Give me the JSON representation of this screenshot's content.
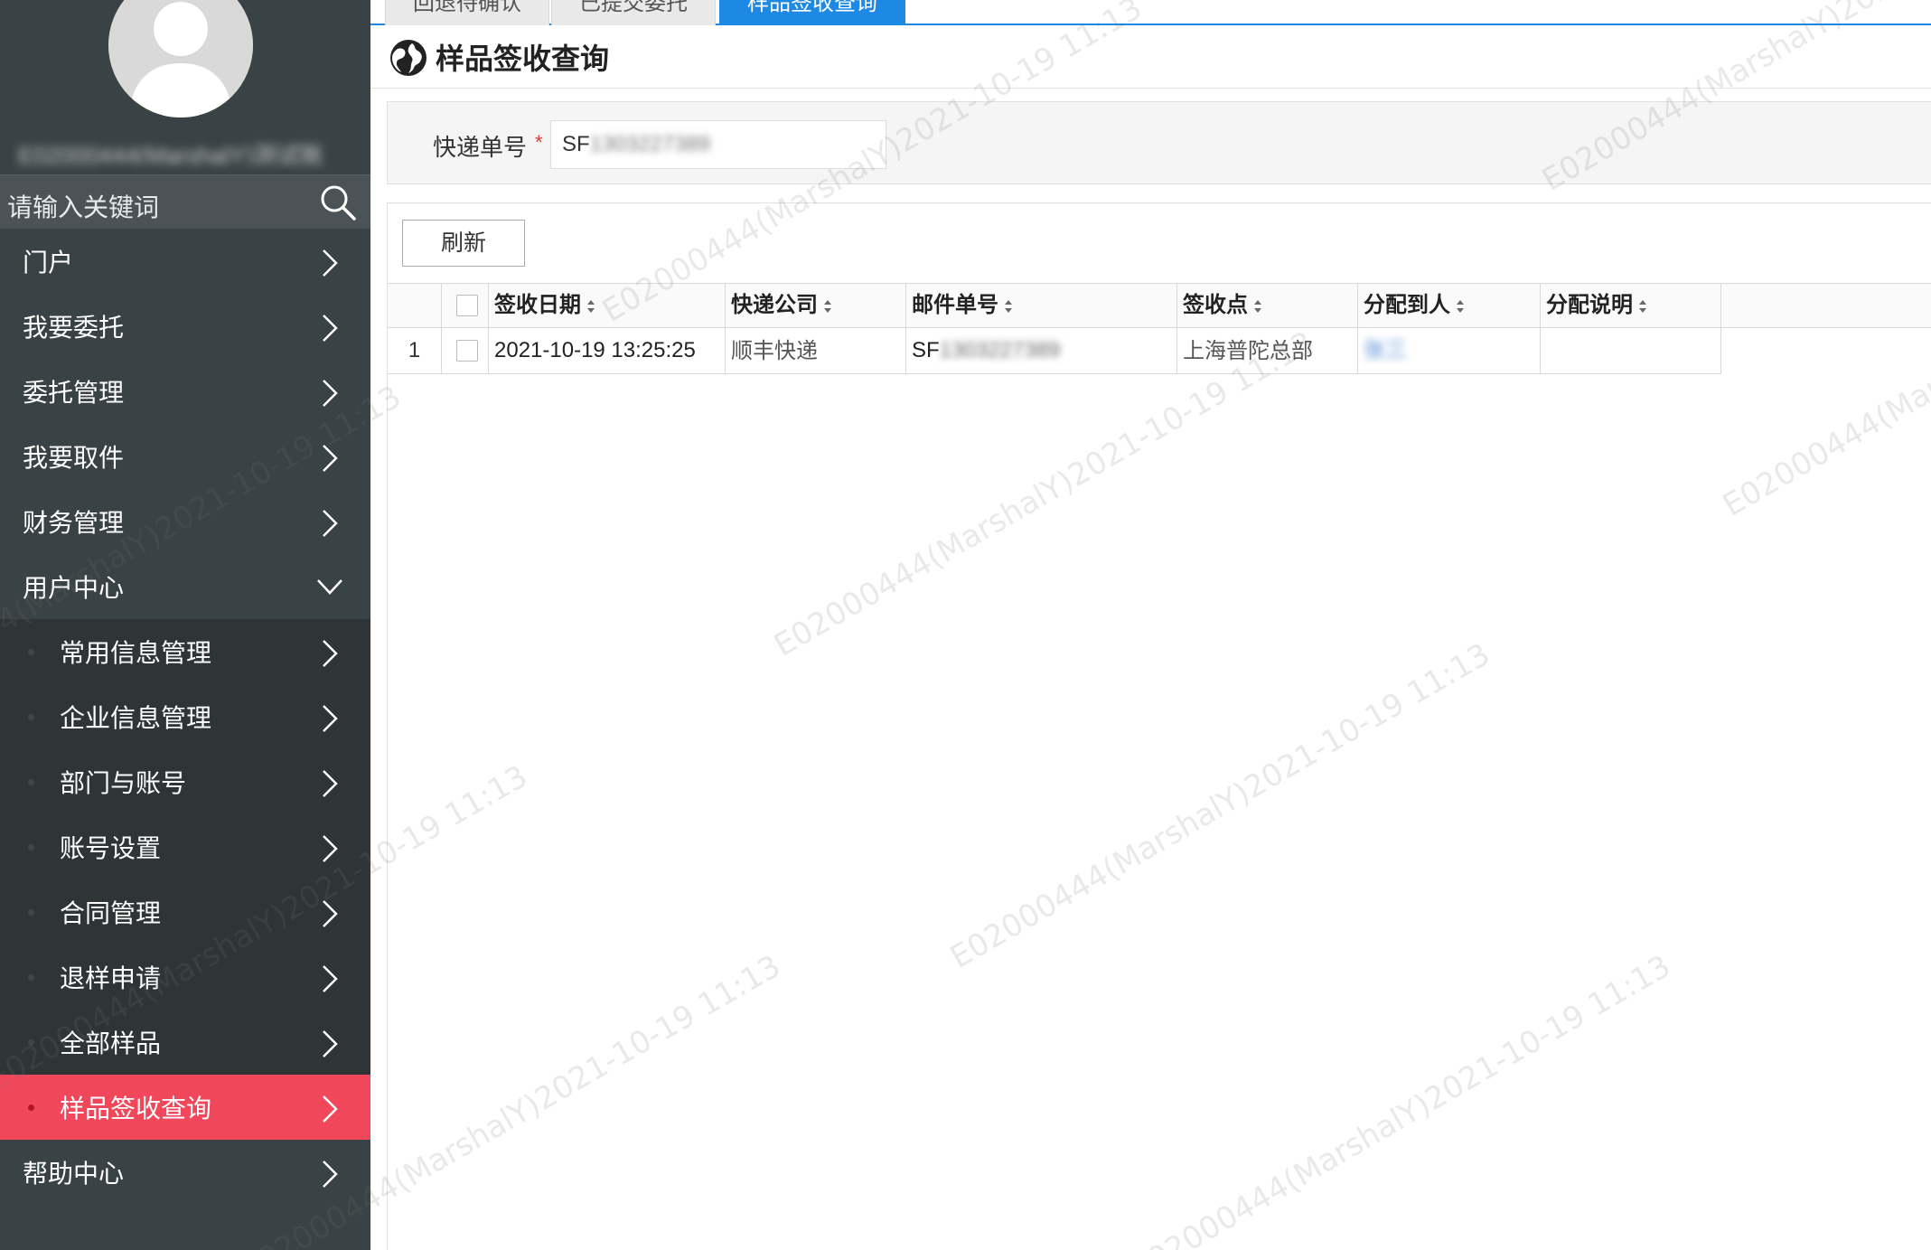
{
  "sidebar": {
    "username": "E02000444(MarshalY)测试账",
    "search_placeholder": "请输入关键词",
    "items": [
      {
        "label": "门户",
        "level": "top"
      },
      {
        "label": "我要委托",
        "level": "top"
      },
      {
        "label": "委托管理",
        "level": "top"
      },
      {
        "label": "我要取件",
        "level": "top"
      },
      {
        "label": "财务管理",
        "level": "top"
      },
      {
        "label": "用户中心",
        "level": "top",
        "expanded": true
      },
      {
        "label": "常用信息管理",
        "level": "sub"
      },
      {
        "label": "企业信息管理",
        "level": "sub"
      },
      {
        "label": "部门与账号",
        "level": "sub"
      },
      {
        "label": "账号设置",
        "level": "sub"
      },
      {
        "label": "合同管理",
        "level": "sub"
      },
      {
        "label": "退样申请",
        "level": "sub"
      },
      {
        "label": "全部样品",
        "level": "sub"
      },
      {
        "label": "样品签收查询",
        "level": "sub",
        "active": true
      },
      {
        "label": "帮助中心",
        "level": "top"
      }
    ]
  },
  "tabs": [
    {
      "label": "回退待确认",
      "active": false
    },
    {
      "label": "已提交委托",
      "active": false
    },
    {
      "label": "样品签收查询",
      "active": true
    }
  ],
  "page": {
    "title": "样品签收查询"
  },
  "filter": {
    "label": "快递单号",
    "required_mark": "*",
    "value_prefix": "SF",
    "value_blurred": "1303227389"
  },
  "toolbar": {
    "refresh_label": "刷新"
  },
  "table": {
    "columns": [
      "签收日期",
      "快递公司",
      "邮件单号",
      "签收点",
      "分配到人",
      "分配说明"
    ],
    "rows": [
      {
        "index": "1",
        "date": "2021-10-19 13:25:25",
        "company": "顺丰快递",
        "tracking_prefix": "SF",
        "tracking_blurred": "1303227389",
        "site": "上海普陀总部",
        "assignee_blurred": "张三",
        "note": ""
      }
    ]
  },
  "watermark": {
    "text": "E02000444(MarshalY)2021-10-19 11:13"
  },
  "colors": {
    "sidebar_bg": "#394244",
    "active_item": "#f0475b",
    "tab_active": "#1e88e5"
  }
}
